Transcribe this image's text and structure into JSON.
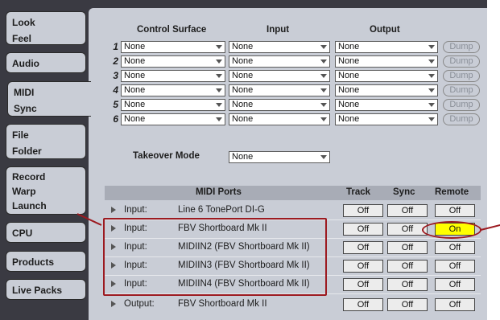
{
  "sidebar": {
    "tabs": [
      {
        "label_1": "Look",
        "label_2": "Feel"
      },
      {
        "label_1": "Audio",
        "label_2": ""
      },
      {
        "label_1": "MIDI",
        "label_2": "Sync"
      },
      {
        "label_1": "File",
        "label_2": "Folder"
      },
      {
        "label_1": "Record",
        "label_2": "Warp",
        "label_3": "Launch"
      },
      {
        "label_1": "CPU",
        "label_2": ""
      },
      {
        "label_1": "Products",
        "label_2": ""
      },
      {
        "label_1": "Live Packs",
        "label_2": ""
      }
    ]
  },
  "surfaces": {
    "headers": {
      "control_surface": "Control Surface",
      "input": "Input",
      "output": "Output"
    },
    "rows": [
      {
        "num": "1",
        "control": "None",
        "input": "None",
        "output": "None",
        "dump": "Dump"
      },
      {
        "num": "2",
        "control": "None",
        "input": "None",
        "output": "None",
        "dump": "Dump"
      },
      {
        "num": "3",
        "control": "None",
        "input": "None",
        "output": "None",
        "dump": "Dump"
      },
      {
        "num": "4",
        "control": "None",
        "input": "None",
        "output": "None",
        "dump": "Dump"
      },
      {
        "num": "5",
        "control": "None",
        "input": "None",
        "output": "None",
        "dump": "Dump"
      },
      {
        "num": "6",
        "control": "None",
        "input": "None",
        "output": "None",
        "dump": "Dump"
      }
    ]
  },
  "takeover": {
    "label": "Takeover Mode",
    "value": "None"
  },
  "ports": {
    "headers": {
      "midi_ports": "MIDI Ports",
      "track": "Track",
      "sync": "Sync",
      "remote": "Remote"
    },
    "rows": [
      {
        "dir": "Input:",
        "name": "Line 6 TonePort DI-G",
        "track": "Off",
        "sync": "Off",
        "remote": "Off"
      },
      {
        "dir": "Input:",
        "name": "FBV Shortboard Mk II",
        "track": "Off",
        "sync": "Off",
        "remote": "On"
      },
      {
        "dir": "Input:",
        "name": "MIDIIN2 (FBV Shortboard Mk II)",
        "track": "Off",
        "sync": "Off",
        "remote": "Off"
      },
      {
        "dir": "Input:",
        "name": "MIDIIN3 (FBV Shortboard Mk II)",
        "track": "Off",
        "sync": "Off",
        "remote": "Off"
      },
      {
        "dir": "Input:",
        "name": "MIDIIN4 (FBV Shortboard Mk II)",
        "track": "Off",
        "sync": "Off",
        "remote": "Off"
      },
      {
        "dir": "Output:",
        "name": "FBV Shortboard Mk II",
        "track": "Off",
        "sync": "Off",
        "remote": "Off"
      }
    ]
  },
  "colors": {
    "highlight_on": "#ffff00",
    "annotation": "#9c1a20",
    "panel": "#c9cdd6",
    "chrome": "#3a3a42"
  }
}
